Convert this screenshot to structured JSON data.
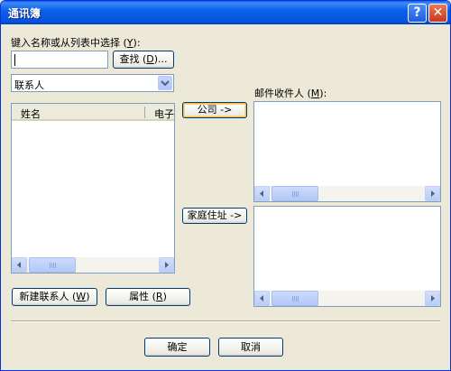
{
  "window": {
    "title": "通讯簿"
  },
  "titlebar": {
    "help_glyph": "?",
    "close_glyph": "✕"
  },
  "search": {
    "label": "键入名称或从列表中选择 (",
    "label_key": "Y",
    "label_tail": "):",
    "value": "",
    "find_button": "查找 (",
    "find_key": "D",
    "find_tail": ")..."
  },
  "source_combo": {
    "selected": "联系人",
    "arrow_glyph": "▼"
  },
  "contacts_list": {
    "columns": [
      "姓名",
      "电子"
    ]
  },
  "actions": {
    "company_button": "公司 ->",
    "home_button": "家庭住址 ->",
    "new_contact": "新建联系人 (",
    "new_contact_key": "W",
    "new_contact_tail": ")",
    "properties": "属性 (",
    "properties_key": "R",
    "properties_tail": ")"
  },
  "recipients": {
    "label": "邮件收件人 (",
    "label_key": "M",
    "label_tail": "):"
  },
  "scroll": {
    "left_glyph": "◀",
    "right_glyph": "▶"
  },
  "footer": {
    "ok": "确定",
    "cancel": "取消"
  },
  "colors": {
    "accent": "#0A5FEA",
    "dialog_bg": "#ECE9D8",
    "focus_ring": "#F5B64C"
  }
}
